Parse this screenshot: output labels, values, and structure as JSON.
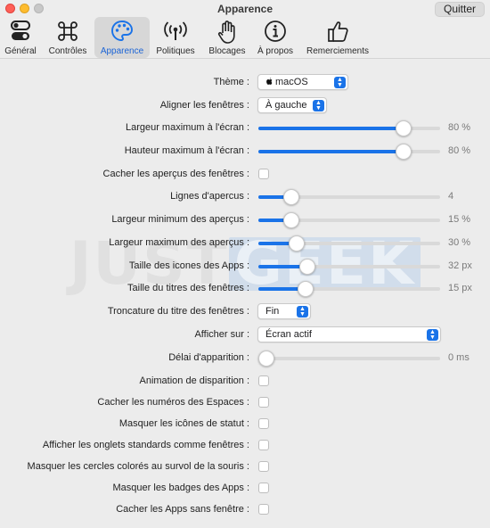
{
  "window": {
    "title": "Apparence",
    "quit_label": "Quitter"
  },
  "tabs": [
    {
      "label": "Général",
      "icon": "toggles-icon"
    },
    {
      "label": "Contrôles",
      "icon": "command-icon"
    },
    {
      "label": "Apparence",
      "icon": "palette-icon",
      "active": true
    },
    {
      "label": "Politiques",
      "icon": "broadcast-icon"
    },
    {
      "label": "Blocages",
      "icon": "hand-icon"
    },
    {
      "label": "À propos",
      "icon": "info-icon"
    },
    {
      "label": "Remerciements",
      "icon": "thumbs-up-icon"
    }
  ],
  "watermark": {
    "part1": "JUST",
    "part2": "GEEK"
  },
  "settings": {
    "theme": {
      "label": "Thème :",
      "value": "macOS",
      "icon": "apple-icon"
    },
    "align": {
      "label": "Aligner les fenêtres :",
      "value": "À gauche"
    },
    "max_width": {
      "label": "Largeur maximum à l'écran :",
      "value": "80 %",
      "level": 0.8
    },
    "max_height": {
      "label": "Hauteur maximum à l'écran :",
      "value": "80 %",
      "level": 0.8
    },
    "hide_previews": {
      "label": "Cacher les aperçus des fenêtres :",
      "checked": false
    },
    "preview_lines": {
      "label": "Lignes d'apercus :",
      "value": "4",
      "level": 0.18
    },
    "min_preview_width": {
      "label": "Largeur minimum des aperçus :",
      "value": "15 %",
      "level": 0.18
    },
    "max_preview_width": {
      "label": "Largeur maximum des aperçus :",
      "value": "30 %",
      "level": 0.21
    },
    "app_icon_size": {
      "label": "Taille des icones des Apps :",
      "value": "32 px",
      "level": 0.27
    },
    "title_size": {
      "label": "Taille du titres des fenêtres :",
      "value": "15 px",
      "level": 0.26
    },
    "title_truncation": {
      "label": "Troncature du titre des fenêtres :",
      "value": "Fin"
    },
    "show_on": {
      "label": "Afficher sur :",
      "value": "Écran actif"
    },
    "appear_delay": {
      "label": "Délai d'apparition :",
      "value": "0 ms",
      "level": 0.0
    },
    "disappear_anim": {
      "label": "Animation de disparition :",
      "checked": false
    },
    "hide_spaces": {
      "label": "Cacher les numéros des Espaces :",
      "checked": false
    },
    "hide_status_icons": {
      "label": "Masquer les icônes de statut :",
      "checked": false
    },
    "show_tabs": {
      "label": "Afficher les onglets standards comme fenêtres :",
      "checked": false
    },
    "hide_hover_circles": {
      "label": "Masquer les cercles colorés au survol de la souris :",
      "checked": false
    },
    "hide_badges": {
      "label": "Masquer les badges des Apps :",
      "checked": false
    },
    "hide_windowless": {
      "label": "Cacher les Apps sans fenêtre :",
      "checked": false
    }
  },
  "colors": {
    "accent": "#1a73e8",
    "window_bg": "#ececec"
  }
}
